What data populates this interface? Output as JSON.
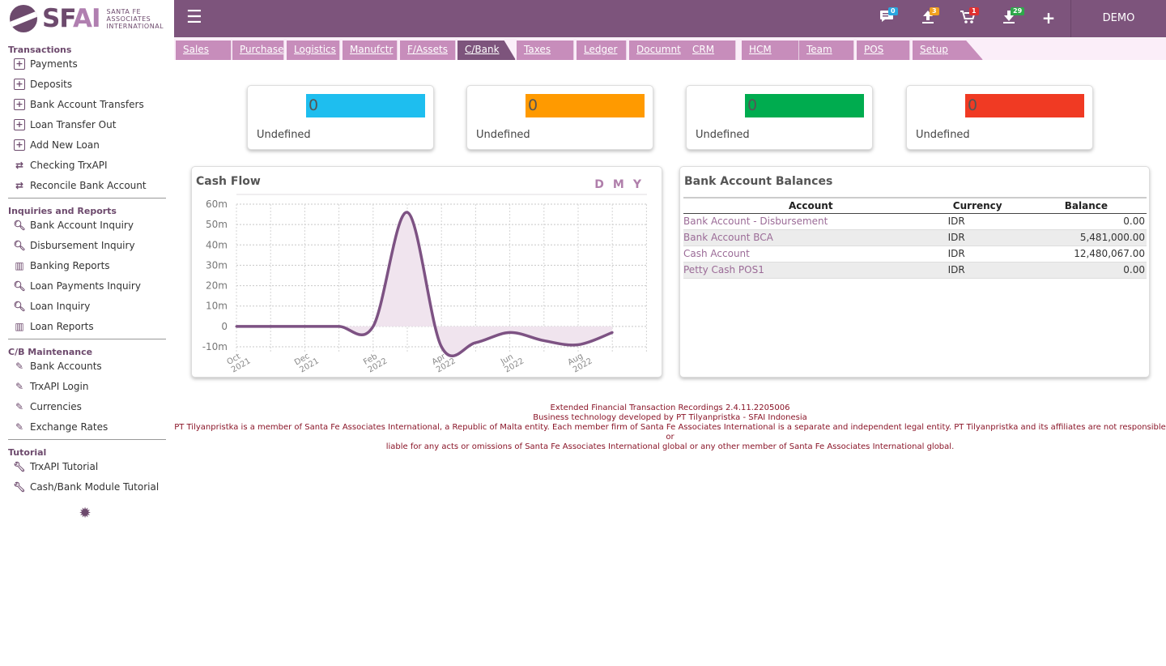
{
  "brand": {
    "logo_text_main": "SF",
    "logo_text_accent": "AI",
    "logo_sub_line1": "SANTA FE",
    "logo_sub_line2": "ASSOCIATES",
    "logo_sub_line3": "INTERNATIONAL"
  },
  "sidebar": {
    "sections": [
      {
        "title": "Transactions",
        "items": [
          {
            "label": "Payments",
            "icon": "add-box-icon"
          },
          {
            "label": "Deposits",
            "icon": "add-box-icon"
          },
          {
            "label": "Bank Account Transfers",
            "icon": "add-box-icon"
          },
          {
            "label": "Loan Transfer Out",
            "icon": "add-box-icon"
          },
          {
            "label": "Add New Loan",
            "icon": "add-box-icon"
          },
          {
            "label": "Checking TrxAPI",
            "icon": "swap-arrows-icon"
          },
          {
            "label": "Reconcile Bank Account",
            "icon": "swap-arrows-icon"
          }
        ]
      },
      {
        "title": "Inquiries and Reports",
        "items": [
          {
            "label": "Bank Account Inquiry",
            "icon": "search-doc-icon"
          },
          {
            "label": "Disbursement Inquiry",
            "icon": "search-doc-icon"
          },
          {
            "label": "Banking Reports",
            "icon": "bar-chart-icon"
          },
          {
            "label": "Loan Payments Inquiry",
            "icon": "search-doc-icon"
          },
          {
            "label": "Loan Inquiry",
            "icon": "search-doc-icon"
          },
          {
            "label": "Loan Reports",
            "icon": "bar-chart-icon"
          }
        ]
      },
      {
        "title": "C/B Maintenance",
        "items": [
          {
            "label": "Bank Accounts",
            "icon": "pencil-icon"
          },
          {
            "label": "TrxAPI Login",
            "icon": "pencil-icon"
          },
          {
            "label": "Currencies",
            "icon": "pencil-icon"
          },
          {
            "label": "Exchange Rates",
            "icon": "pencil-icon"
          }
        ]
      },
      {
        "title": "Tutorial",
        "items": [
          {
            "label": "TrxAPI Tutorial",
            "icon": "wrench-icon"
          },
          {
            "label": "Cash/Bank Module Tutorial",
            "icon": "wrench-icon"
          }
        ]
      }
    ]
  },
  "topbar": {
    "badges": {
      "messages": "0",
      "uploads": "3",
      "cart": "1",
      "downloads": "29"
    },
    "badge_colors": {
      "messages": "#2aa6e0",
      "uploads": "#f0a020",
      "cart": "#e03030",
      "downloads": "#2ea84a"
    },
    "user": "DEMO"
  },
  "tabs": [
    "Sales",
    "Purchase",
    "Logistics",
    "Manufctr",
    "F/Assets",
    "C/Bank",
    "Taxes",
    "Ledger",
    "Documnt",
    "CRM",
    "HCM",
    "Team",
    "POS",
    "Setup"
  ],
  "active_tab": "C/Bank",
  "kpis": [
    {
      "value": "0",
      "label": "Undefined",
      "color": "#1ebeef"
    },
    {
      "value": "0",
      "label": "Undefined",
      "color": "#ff9a00"
    },
    {
      "value": "0",
      "label": "Undefined",
      "color": "#00ac4f"
    },
    {
      "value": "0",
      "label": "Undefined",
      "color": "#f03a23"
    }
  ],
  "cashflow": {
    "title": "Cash Flow",
    "controls": [
      "D",
      "M",
      "Y"
    ]
  },
  "chart_data": {
    "type": "area",
    "title": "Cash Flow",
    "x": [
      "Oct 2021",
      "Nov 2021",
      "Dec 2021",
      "Jan 2022",
      "Feb 2022",
      "Mar 2022",
      "Apr 2022",
      "May 2022",
      "Jun 2022",
      "Jul 2022",
      "Aug 2022",
      "Sep 2022"
    ],
    "x_tick_labels": [
      [
        "Oct",
        "2021"
      ],
      [
        "Dec",
        "2021"
      ],
      [
        "Feb",
        "2022"
      ],
      [
        "Apr",
        "2022"
      ],
      [
        "Jun",
        "2022"
      ],
      [
        "Aug",
        "2022"
      ]
    ],
    "values": [
      0,
      0,
      0,
      0,
      0,
      56,
      -10,
      -8,
      -3,
      -7,
      -9,
      -3
    ],
    "y_ticks": [
      "60m",
      "50m",
      "40m",
      "30m",
      "20m",
      "10m",
      "0",
      "-10m"
    ],
    "ylim": [
      -10,
      60
    ],
    "grid": true,
    "line_color": "#7d5283",
    "fill_color": "#f0e4ee"
  },
  "balances": {
    "title": "Bank Account Balances",
    "columns": [
      "Account",
      "Currency",
      "Balance"
    ],
    "rows": [
      {
        "account": "Bank Account - Disbursement",
        "currency": "IDR",
        "balance": "0.00"
      },
      {
        "account": "Bank Account BCA",
        "currency": "IDR",
        "balance": "5,481,000.00"
      },
      {
        "account": "Cash Account",
        "currency": "IDR",
        "balance": "12,480,067.00"
      },
      {
        "account": "Petty Cash POS1",
        "currency": "IDR",
        "balance": "0.00"
      }
    ]
  },
  "footer": {
    "line1": "Extended Financial Transaction Recordings 2.4.11.2205006",
    "line2": "Business technology developed by PT Tilyanpristka - SFAI Indonesia",
    "line3": "PT Tilyanpristka is a member of Santa Fe Associates International, a Republic of Malta entity. Each member firm of Santa Fe Associates International is a separate and independent legal entity. PT Tilyanpristka and its affiliates are not responsible or",
    "line4": "liable for any acts or omissions of Santa Fe Associates International global or any other member of Santa Fe Associates International global."
  }
}
